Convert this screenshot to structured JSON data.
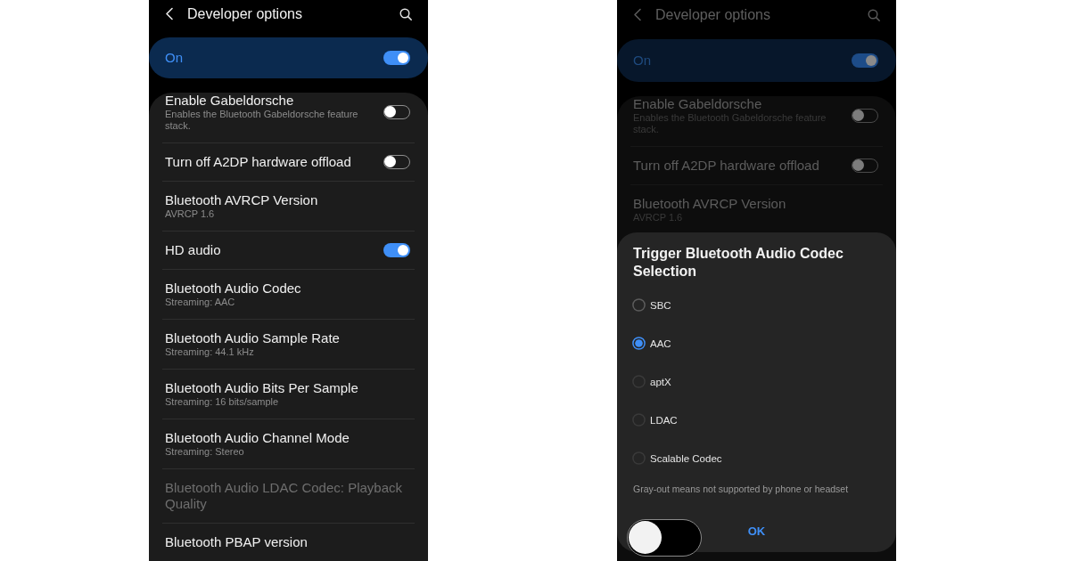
{
  "screens": [
    {
      "dimmed": false,
      "header": {
        "title": "Developer options"
      },
      "master_switch": {
        "label": "On",
        "on": true
      },
      "settings": [
        {
          "kind": "switch",
          "title": "Enable Gabeldorsche",
          "summary": "Enables the Bluetooth Gabeldorsche feature stack.",
          "on": false,
          "disabled": false
        },
        {
          "kind": "switch",
          "title": "Turn off A2DP hardware offload",
          "on": false,
          "disabled": false
        },
        {
          "kind": "value",
          "title": "Bluetooth AVRCP Version",
          "summary": "AVRCP 1.6",
          "disabled": false
        },
        {
          "kind": "switch",
          "title": "HD audio",
          "on": true,
          "disabled": false
        },
        {
          "kind": "value",
          "title": "Bluetooth Audio Codec",
          "summary": "Streaming: AAC",
          "disabled": false
        },
        {
          "kind": "value",
          "title": "Bluetooth Audio Sample Rate",
          "summary": "Streaming: 44.1 kHz",
          "disabled": false
        },
        {
          "kind": "value",
          "title": "Bluetooth Audio Bits Per Sample",
          "summary": "Streaming: 16 bits/sample",
          "disabled": false
        },
        {
          "kind": "value",
          "title": "Bluetooth Audio Channel Mode",
          "summary": "Streaming: Stereo",
          "disabled": false
        },
        {
          "kind": "value",
          "title": "Bluetooth Audio LDAC Codec: Playback Quality",
          "disabled": true
        },
        {
          "kind": "value",
          "title": "Bluetooth PBAP version",
          "disabled": false
        }
      ]
    },
    {
      "dimmed": true,
      "header": {
        "title": "Developer options"
      },
      "master_switch": {
        "label": "On",
        "on": true
      },
      "settings": [
        {
          "kind": "switch",
          "title": "Enable Gabeldorsche",
          "summary": "Enables the Bluetooth Gabeldorsche feature stack.",
          "on": false,
          "disabled": false
        },
        {
          "kind": "switch",
          "title": "Turn off A2DP hardware offload",
          "on": false,
          "disabled": false
        },
        {
          "kind": "value",
          "title": "Bluetooth AVRCP Version",
          "summary": "AVRCP 1.6",
          "disabled": false
        }
      ],
      "dialog": {
        "title": "Trigger Bluetooth Audio Codec Selection",
        "options": [
          {
            "label": "SBC",
            "selected": false,
            "disabled": false
          },
          {
            "label": "AAC",
            "selected": true,
            "disabled": false
          },
          {
            "label": "aptX",
            "selected": false,
            "disabled": true
          },
          {
            "label": "LDAC",
            "selected": false,
            "disabled": true
          },
          {
            "label": "Scalable Codec",
            "selected": false,
            "disabled": true
          }
        ],
        "note": "Gray-out means not supported by phone or headset",
        "button": "OK"
      },
      "floating_switch": {
        "on": false
      }
    }
  ]
}
